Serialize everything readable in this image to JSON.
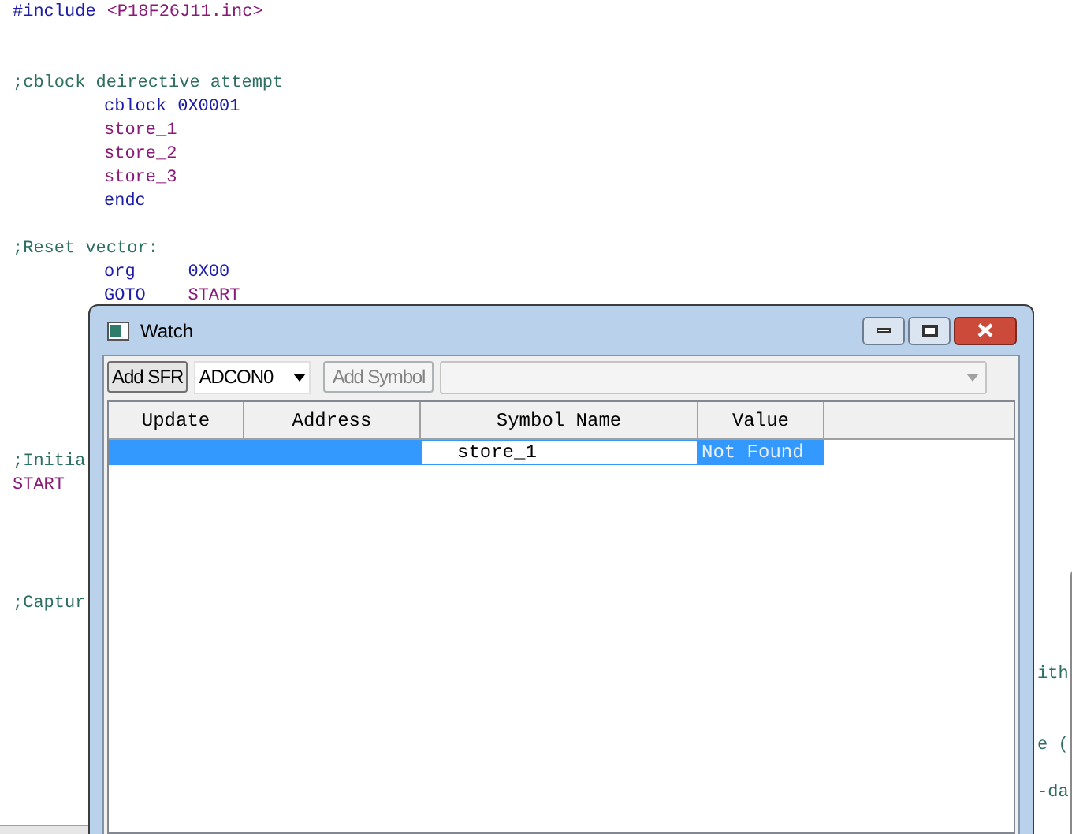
{
  "editor": {
    "lines": [
      {
        "kind": "code",
        "indent": false,
        "tokens": [
          {
            "kind": "directive",
            "text": "#include"
          },
          {
            "kind": "symbol",
            "text": "<P18F26J11.inc>"
          }
        ]
      },
      {
        "kind": "blank"
      },
      {
        "kind": "blank"
      },
      {
        "kind": "code",
        "indent": false,
        "tokens": [
          {
            "kind": "comment",
            "text": ";cblock deirective attempt"
          }
        ]
      },
      {
        "kind": "code",
        "indent": true,
        "tokens": [
          {
            "kind": "directive",
            "text": "cblock"
          },
          {
            "kind": "directive",
            "text": "0X0001"
          }
        ]
      },
      {
        "kind": "code",
        "indent": true,
        "tokens": [
          {
            "kind": "symbol",
            "text": "store_1"
          }
        ]
      },
      {
        "kind": "code",
        "indent": true,
        "tokens": [
          {
            "kind": "symbol",
            "text": "store_2"
          }
        ]
      },
      {
        "kind": "code",
        "indent": true,
        "tokens": [
          {
            "kind": "symbol",
            "text": "store_3"
          }
        ]
      },
      {
        "kind": "code",
        "indent": true,
        "tokens": [
          {
            "kind": "directive",
            "text": "endc"
          }
        ]
      },
      {
        "kind": "blank"
      },
      {
        "kind": "code",
        "indent": false,
        "tokens": [
          {
            "kind": "comment",
            "text": ";Reset vector:"
          }
        ]
      },
      {
        "kind": "code",
        "indent": true,
        "tokens": [
          {
            "kind": "directive",
            "text": "org    "
          },
          {
            "kind": "directive",
            "text": "0X00"
          }
        ]
      },
      {
        "kind": "code",
        "indent": true,
        "tokens": [
          {
            "kind": "directive",
            "text": "GOTO   "
          },
          {
            "kind": "symbol",
            "text": "START"
          }
        ]
      },
      {
        "kind": "blank"
      },
      {
        "kind": "blank"
      },
      {
        "kind": "blank"
      },
      {
        "kind": "blank"
      },
      {
        "kind": "blank"
      },
      {
        "kind": "blank"
      },
      {
        "kind": "code",
        "indent": false,
        "tokens": [
          {
            "kind": "comment",
            "text": ";Initia"
          }
        ]
      },
      {
        "kind": "code",
        "indent": false,
        "tokens": [
          {
            "kind": "symbol",
            "text": "START"
          }
        ]
      },
      {
        "kind": "blank"
      },
      {
        "kind": "blank"
      },
      {
        "kind": "blank"
      },
      {
        "kind": "blank"
      },
      {
        "kind": "code",
        "indent": false,
        "tokens": [
          {
            "kind": "comment",
            "text": ";Captur"
          }
        ]
      },
      {
        "kind": "blank"
      },
      {
        "kind": "blank"
      },
      {
        "kind": "tail",
        "text": "ith"
      },
      {
        "kind": "blank"
      },
      {
        "kind": "blank"
      },
      {
        "kind": "tail",
        "text": "e ("
      },
      {
        "kind": "blank"
      },
      {
        "kind": "tail",
        "text": "-da"
      }
    ]
  },
  "watch": {
    "title": "Watch",
    "toolbar": {
      "add_sfr": "Add SFR",
      "sfr_select": "ADCON0",
      "add_symbol": {
        "label": "Add Symbol",
        "disabled": true
      },
      "symbol_combo": {
        "disabled": true
      }
    },
    "columns": [
      "Update",
      "Address",
      "Symbol Name",
      "Value"
    ],
    "rows": [
      {
        "symbol_name": "store_1",
        "value": "Not Found",
        "selected": true,
        "editing": true
      }
    ]
  }
}
